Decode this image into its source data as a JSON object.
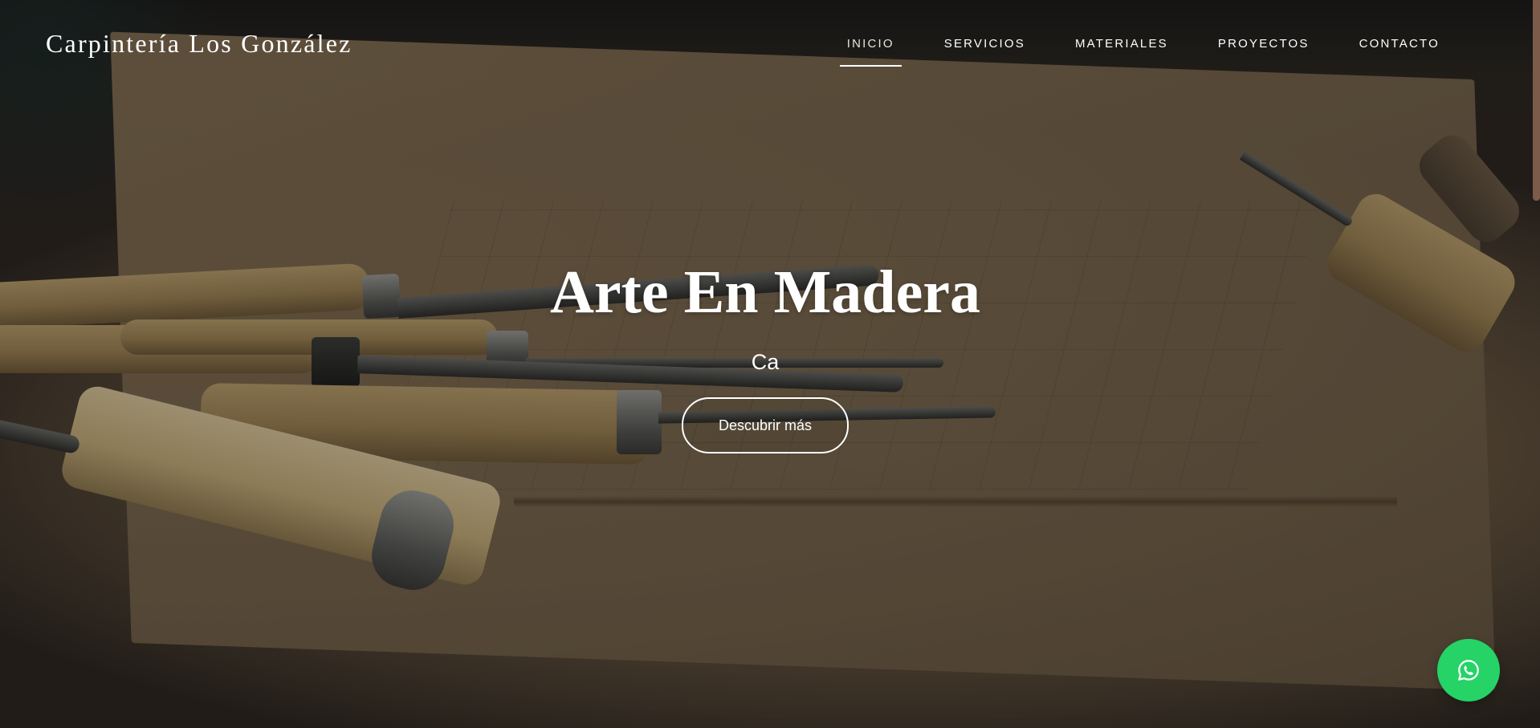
{
  "brand": {
    "name": "Carpintería Los González"
  },
  "nav": {
    "items": [
      {
        "label": "INICIO",
        "active": true
      },
      {
        "label": "SERVICIOS",
        "active": false
      },
      {
        "label": "MATERIALES",
        "active": false
      },
      {
        "label": "PROYECTOS",
        "active": false
      },
      {
        "label": "CONTACTO",
        "active": false
      }
    ]
  },
  "hero": {
    "title": "Arte En Madera",
    "subtitle": "Ca",
    "button_label": "Descubrir más",
    "background": "woodworking-chisels-photo"
  },
  "floating": {
    "whatsapp_icon": "whatsapp-icon",
    "whatsapp_color": "#25d366"
  }
}
